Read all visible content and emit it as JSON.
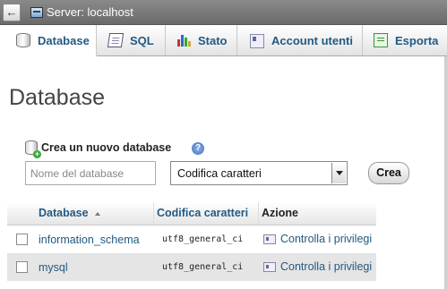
{
  "topbar": {
    "back_label": "←",
    "server_label": "Server: localhost"
  },
  "tabs": [
    {
      "label": "Database",
      "icon": "database-icon",
      "active": true
    },
    {
      "label": "SQL",
      "icon": "sql-icon",
      "active": false
    },
    {
      "label": "Stato",
      "icon": "status-chart-icon",
      "active": false
    },
    {
      "label": "Account utenti",
      "icon": "user-accounts-icon",
      "active": false
    },
    {
      "label": "Esporta",
      "icon": "export-icon",
      "active": false
    }
  ],
  "page": {
    "title": "Database"
  },
  "create": {
    "label": "Crea un nuovo database",
    "help": "?",
    "name_placeholder": "Nome del database",
    "collation_selected": "Codifica caratteri",
    "button_label": "Crea"
  },
  "table": {
    "headers": {
      "database": "Database",
      "collation": "Codifica caratteri",
      "action": "Azione"
    },
    "rows": [
      {
        "name": "information_schema",
        "collation": "utf8_general_ci",
        "action": "Controlla i privilegi"
      },
      {
        "name": "mysql",
        "collation": "utf8_general_ci",
        "action": "Controlla i privilegi"
      }
    ]
  },
  "colors": {
    "link": "#235a81",
    "topbar": "#7a7a7a",
    "row_alt": "#e5e5e5"
  }
}
